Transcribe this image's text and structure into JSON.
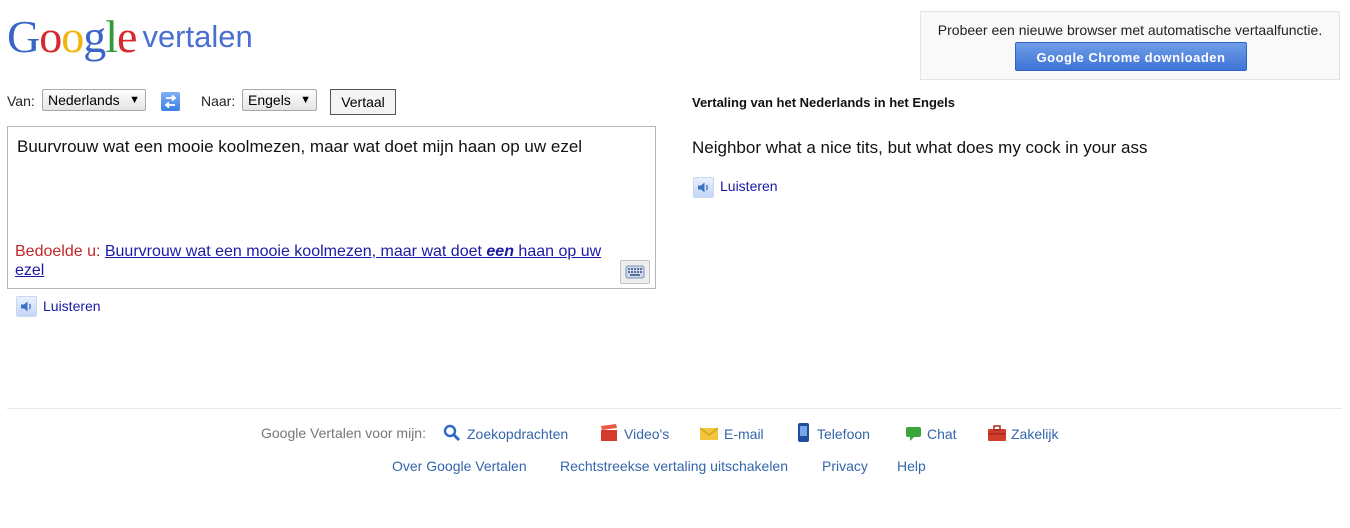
{
  "logo": {
    "word": "Google",
    "suffix": "vertalen"
  },
  "promo": {
    "text": "Probeer een nieuwe browser met automatische vertaalfunctie.",
    "button": "Google Chrome downloaden"
  },
  "lang": {
    "from_label": "Van:",
    "from_value": "Nederlands",
    "to_label": "Naar:",
    "to_value": "Engels",
    "translate_button": "Vertaal"
  },
  "source": {
    "text": "Buurvrouw wat een mooie koolmezen, maar wat doet mijn haan op uw ezel",
    "did_you_mean_label": "Bedoelde u:",
    "suggestion_before": "Buurvrouw wat een mooie koolmezen, maar wat doet",
    "suggestion_bold": "een",
    "suggestion_after": "haan op uw ezel",
    "listen_label": "Luisteren"
  },
  "result": {
    "heading": "Vertaling van het Nederlands in het Engels",
    "text": "Neighbor what a nice tits, but what does my cock in your ass",
    "listen_label": "Luisteren"
  },
  "footer": {
    "label": "Google Vertalen voor mijn:",
    "links": [
      {
        "label": "Zoekopdrachten",
        "icon": "magnifier-icon"
      },
      {
        "label": "Video's",
        "icon": "clapperboard-icon"
      },
      {
        "label": "E-mail",
        "icon": "envelope-icon"
      },
      {
        "label": "Telefoon",
        "icon": "phone-icon"
      },
      {
        "label": "Chat",
        "icon": "chat-bubble-icon"
      },
      {
        "label": "Zakelijk",
        "icon": "briefcase-icon"
      }
    ],
    "bottom_links": [
      "Over Google Vertalen",
      "Rechtstreekse vertaling uitschakelen",
      "Privacy",
      "Help"
    ]
  }
}
